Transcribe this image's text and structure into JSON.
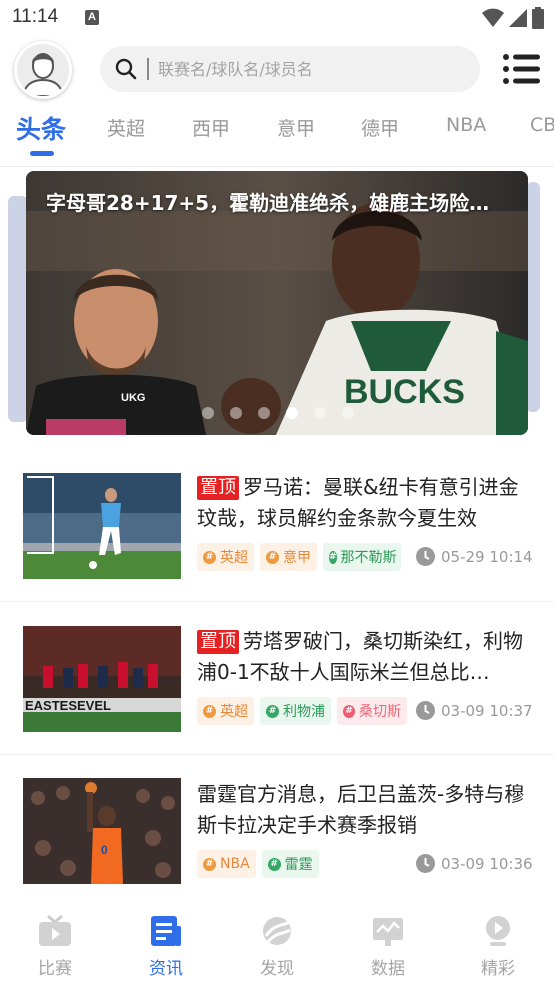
{
  "status_bar": {
    "time": "11:14",
    "notification_badge": "A"
  },
  "header": {
    "search_placeholder": "联赛名/球队名/球员名"
  },
  "tabs": [
    {
      "label": "头条",
      "active": true
    },
    {
      "label": "英超"
    },
    {
      "label": "西甲"
    },
    {
      "label": "意甲"
    },
    {
      "label": "德甲"
    },
    {
      "label": "NBA"
    },
    {
      "label": "CB"
    }
  ],
  "banner": {
    "title": "字母哥28+17+5，霍勒迪准绝杀，雄鹿主场险…",
    "dot_count": 6,
    "active_dot": 3
  },
  "news": [
    {
      "pinned": true,
      "pin_label": "置顶",
      "title": "罗马诺：曼联&纽卡有意引进金玟哉，球员解约金条款今夏生效",
      "tags": [
        {
          "label": "英超",
          "color": "orange"
        },
        {
          "label": "意甲",
          "color": "orange"
        },
        {
          "label": "那不勒斯",
          "color": "green"
        }
      ],
      "time": "05-29 10:14"
    },
    {
      "pinned": true,
      "pin_label": "置顶",
      "title": "劳塔罗破门，桑切斯染红，利物浦0-1不敌十人国际米兰但总比…",
      "tags": [
        {
          "label": "英超",
          "color": "orange"
        },
        {
          "label": "利物浦",
          "color": "green"
        },
        {
          "label": "桑切斯",
          "color": "pink"
        }
      ],
      "time": "03-09 10:37"
    },
    {
      "pinned": false,
      "title": "雷霆官方消息，后卫吕盖茨-多特与穆斯卡拉决定手术赛季报销",
      "tags": [
        {
          "label": "NBA",
          "color": "orange"
        },
        {
          "label": "雷霆",
          "color": "green"
        }
      ],
      "time": "03-09 10:36"
    }
  ],
  "bottom_nav": [
    {
      "label": "比赛",
      "icon": "tv-icon"
    },
    {
      "label": "资讯",
      "icon": "news-icon",
      "active": true
    },
    {
      "label": "发现",
      "icon": "discover-icon"
    },
    {
      "label": "数据",
      "icon": "data-icon"
    },
    {
      "label": "精彩",
      "icon": "play-icon"
    }
  ],
  "colors": {
    "accent": "#2f6ee8",
    "pin": "#e52121"
  }
}
